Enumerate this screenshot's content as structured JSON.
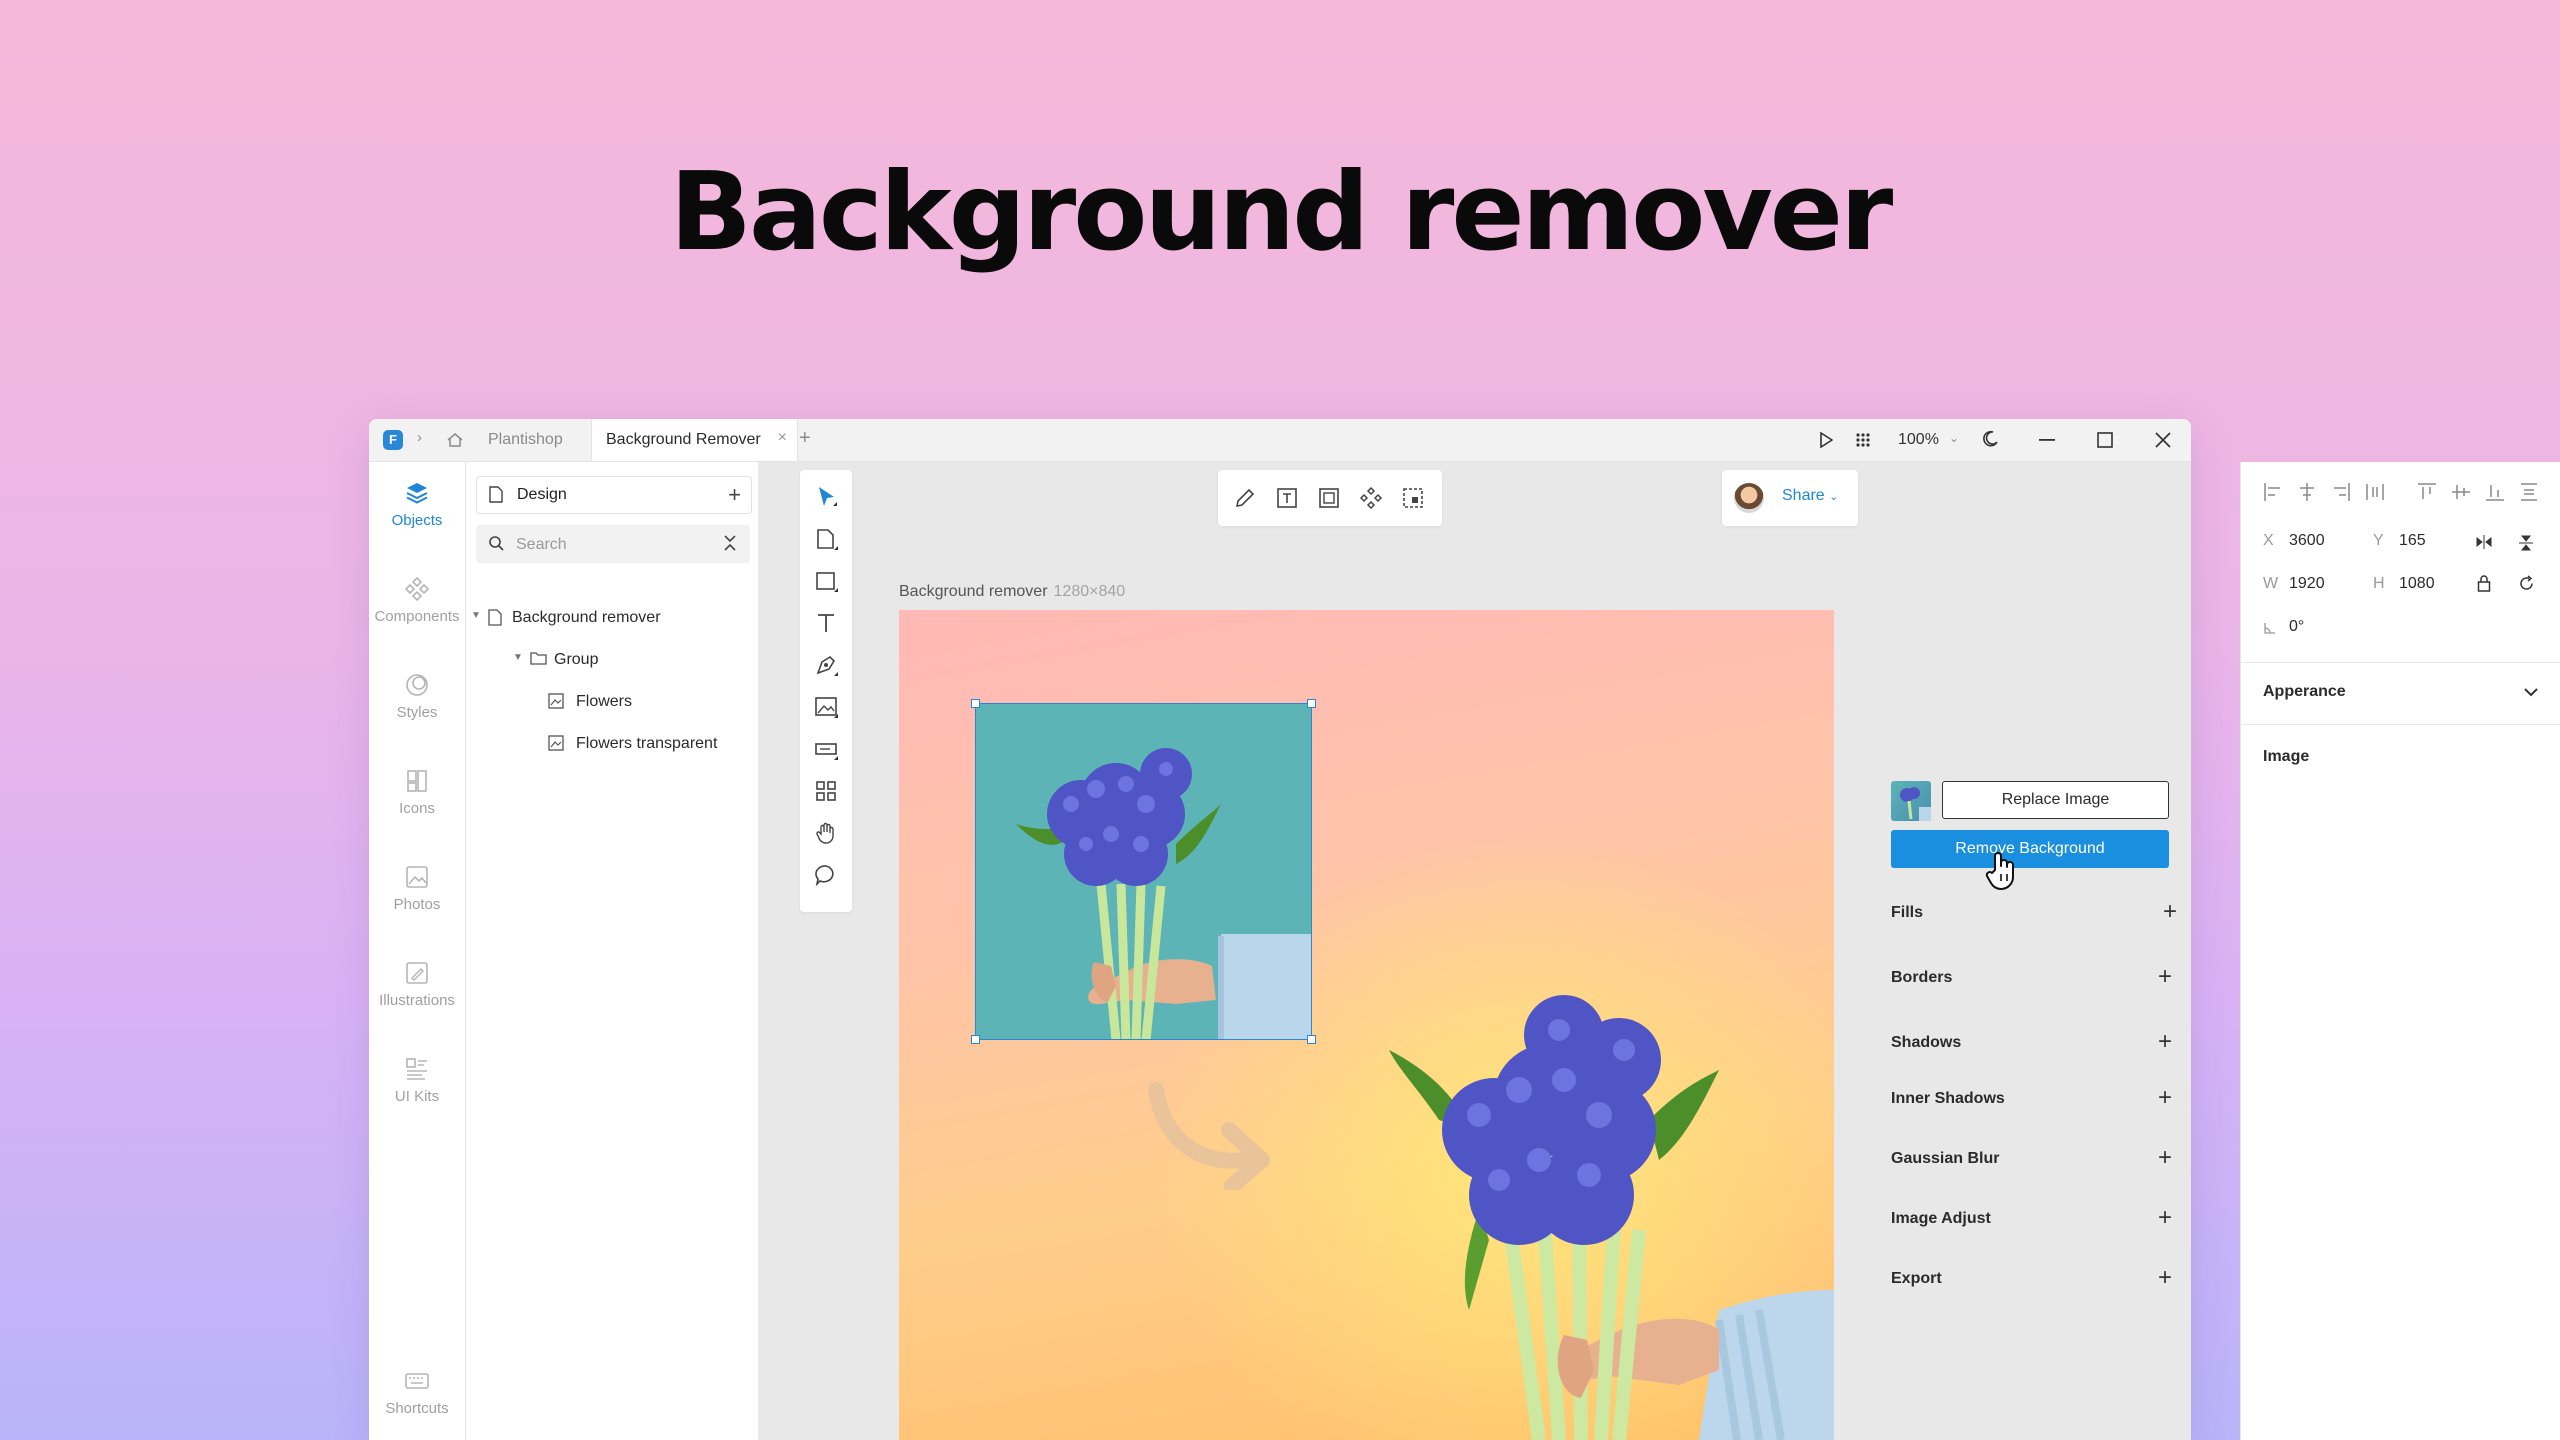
{
  "hero": {
    "title": "Background remover"
  },
  "titlebar": {
    "breadcrumb_project": "Plantishop",
    "active_tab": "Background Remover",
    "tab_close": "×",
    "new_tab": "+",
    "zoom": "100%"
  },
  "rail": {
    "items": [
      {
        "label": "Objects",
        "icon": "layers-icon"
      },
      {
        "label": "Components",
        "icon": "components-icon"
      },
      {
        "label": "Styles",
        "icon": "styles-icon"
      },
      {
        "label": "Icons",
        "icon": "icons-icon"
      },
      {
        "label": "Photos",
        "icon": "photos-icon"
      },
      {
        "label": "Illustrations",
        "icon": "illustrations-icon"
      },
      {
        "label": "UI Kits",
        "icon": "ui-kits-icon"
      }
    ],
    "shortcuts": "Shortcuts"
  },
  "layers": {
    "page": "Design",
    "page_add": "+",
    "search_placeholder": "Search",
    "tree": [
      {
        "label": "Background remover",
        "type": "frame"
      },
      {
        "label": "Group",
        "type": "group"
      },
      {
        "label": "Flowers",
        "type": "image"
      },
      {
        "label": "Flowers transparent",
        "type": "image"
      }
    ]
  },
  "canvas": {
    "frame_name": "Background remover",
    "frame_size": "1280×840"
  },
  "share": {
    "label": "Share"
  },
  "properties": {
    "x_label": "X",
    "x": "3600",
    "y_label": "Y",
    "y": "165",
    "w_label": "W",
    "w": "1920",
    "h_label": "H",
    "h": "1080",
    "rotation": "0°",
    "appearance": "Apperance",
    "image_section": "Image",
    "replace_image": "Replace Image",
    "remove_background": "Remove Background",
    "sections": [
      "Fills",
      "Borders",
      "Shadows",
      "Inner Shadows",
      "Gaussian Blur",
      "Image Adjust",
      "Export"
    ],
    "add": "+"
  },
  "colors": {
    "accent": "#1f86d6",
    "button_primary": "#1a8fe0",
    "photo_bg": "#5db4b6"
  }
}
